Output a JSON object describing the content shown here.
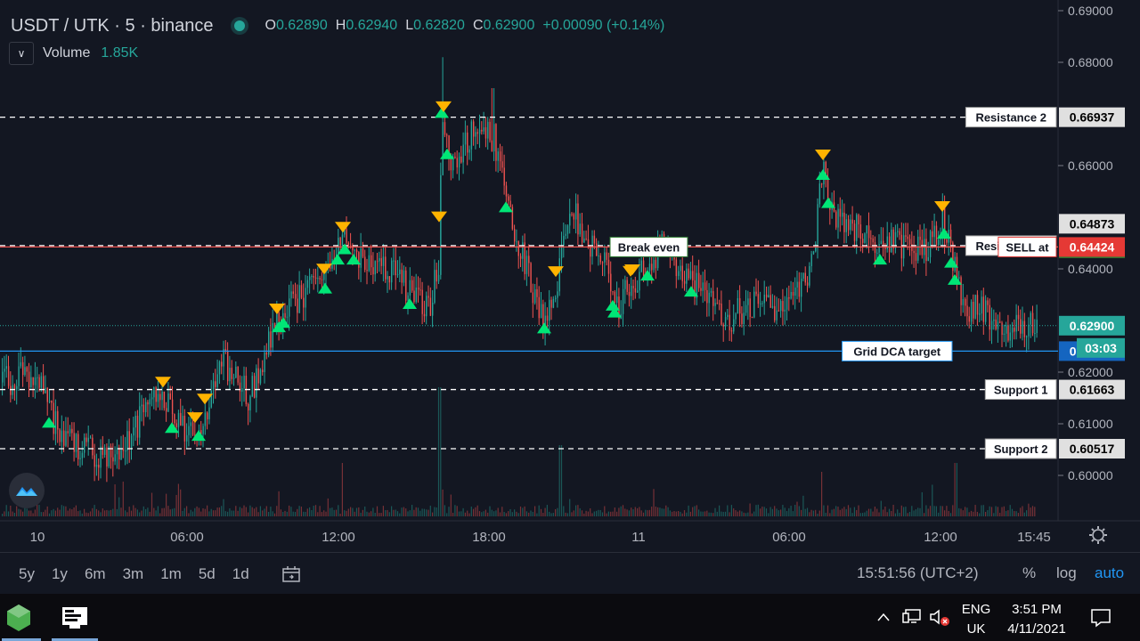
{
  "header": {
    "symbol": "USDT / UTK · 5 · binance",
    "ohlc": [
      {
        "key": "O",
        "val": "0.62890"
      },
      {
        "key": "H",
        "val": "0.62940"
      },
      {
        "key": "L",
        "val": "0.62820"
      },
      {
        "key": "C",
        "val": "0.62900"
      },
      {
        "key": "",
        "val": "+0.00090 (+0.14%)"
      }
    ]
  },
  "volume": {
    "label": "Volume",
    "value": "1.85K"
  },
  "colors": {
    "bg": "#131722",
    "up": "#26a69a",
    "down": "#ef5350",
    "buy_marker": "#00e676",
    "sell_marker": "#ffb300",
    "accent": "#2196f3"
  },
  "chart_data": {
    "type": "candlestick",
    "y_axis": {
      "min": 0.59,
      "max": 0.69,
      "ticks": [
        "0.69000",
        "0.68000",
        "0.66000",
        "0.64000",
        "0.62000",
        "0.61000",
        "0.60000"
      ]
    },
    "x_axis": {
      "ticks": [
        "10",
        "06:00",
        "12:00",
        "18:00",
        "11",
        "06:00",
        "12:00",
        "15:45"
      ]
    },
    "lines": [
      {
        "name": "Resistance 2",
        "value": 0.66937,
        "label": "Resistance 2",
        "price_label": "0.66937",
        "style": "dashed",
        "color": "#ffffff"
      },
      {
        "name": "Resistance 1",
        "value": 0.6445,
        "label": "Resistance 1",
        "price_label": "0.64450",
        "style": "dashed",
        "color": "#ffffff"
      },
      {
        "name": "SELL at",
        "value": 0.64424,
        "label": "SELL at",
        "price_label": "0.64424",
        "style": "solid",
        "color": "#ef5350"
      },
      {
        "name": "Break even",
        "value": 0.64424,
        "label": "Break even"
      },
      {
        "name": "Grid DCA target",
        "value": 0.62407,
        "label": "Grid DCA target",
        "price_label": "0.62407",
        "style": "solid",
        "color": "#2196f3"
      },
      {
        "name": "Support 1",
        "value": 0.61663,
        "label": "Support 1",
        "price_label": "0.61663",
        "style": "dashed",
        "color": "#ffffff"
      },
      {
        "name": "Support 2",
        "value": 0.60517,
        "label": "Support 2",
        "price_label": "0.60517",
        "style": "dashed",
        "color": "#ffffff"
      }
    ],
    "price_tags": [
      {
        "value": 0.64873,
        "text": "0.64873",
        "bg": "#e0e0e0",
        "fg": "#000000"
      },
      {
        "value": 0.629,
        "text": "0.62900",
        "bg": "#26a69a",
        "fg": "#ffffff"
      }
    ],
    "countdown": "03:03",
    "buy_markers_x": [
      55,
      193,
      223,
      313,
      318,
      365,
      379,
      387,
      397,
      460,
      496,
      502,
      568,
      611,
      688,
      690,
      727,
      776,
      924,
      930,
      988,
      1060,
      1068,
      1072
    ],
    "sell_markers_x": [
      183,
      219,
      230,
      311,
      364,
      385,
      493,
      498,
      624,
      710,
      708,
      734,
      924,
      1058
    ],
    "anchor_closes": [
      [
        0,
        0.618
      ],
      [
        40,
        0.62
      ],
      [
        55,
        0.612
      ],
      [
        80,
        0.606
      ],
      [
        110,
        0.604
      ],
      [
        140,
        0.606
      ],
      [
        165,
        0.613
      ],
      [
        183,
        0.616
      ],
      [
        195,
        0.61
      ],
      [
        222,
        0.609
      ],
      [
        250,
        0.622
      ],
      [
        280,
        0.615
      ],
      [
        310,
        0.63
      ],
      [
        340,
        0.635
      ],
      [
        365,
        0.638
      ],
      [
        385,
        0.646
      ],
      [
        400,
        0.643
      ],
      [
        420,
        0.64
      ],
      [
        440,
        0.64
      ],
      [
        460,
        0.635
      ],
      [
        480,
        0.632
      ],
      [
        492,
        0.64
      ],
      [
        496,
        0.672
      ],
      [
        505,
        0.66
      ],
      [
        520,
        0.664
      ],
      [
        540,
        0.668
      ],
      [
        555,
        0.665
      ],
      [
        570,
        0.652
      ],
      [
        590,
        0.64
      ],
      [
        605,
        0.632
      ],
      [
        612,
        0.63
      ],
      [
        625,
        0.638
      ],
      [
        640,
        0.652
      ],
      [
        660,
        0.645
      ],
      [
        680,
        0.64
      ],
      [
        692,
        0.632
      ],
      [
        705,
        0.637
      ],
      [
        725,
        0.64
      ],
      [
        745,
        0.645
      ],
      [
        770,
        0.638
      ],
      [
        790,
        0.636
      ],
      [
        815,
        0.63
      ],
      [
        840,
        0.633
      ],
      [
        865,
        0.632
      ],
      [
        890,
        0.636
      ],
      [
        910,
        0.64
      ],
      [
        924,
        0.66
      ],
      [
        935,
        0.65
      ],
      [
        960,
        0.648
      ],
      [
        985,
        0.643
      ],
      [
        1000,
        0.646
      ],
      [
        1020,
        0.644
      ],
      [
        1040,
        0.643
      ],
      [
        1058,
        0.65
      ],
      [
        1068,
        0.643
      ],
      [
        1080,
        0.633
      ],
      [
        1100,
        0.632
      ],
      [
        1130,
        0.629
      ],
      [
        1160,
        0.629
      ]
    ]
  },
  "bottom_bar": {
    "ranges": [
      "5y",
      "1y",
      "6m",
      "3m",
      "1m",
      "5d",
      "1d"
    ],
    "clock": "15:51:56 (UTC+2)",
    "percent": "%",
    "log": "log",
    "auto": "auto"
  },
  "taskbar": {
    "lang_top": "ENG",
    "lang_bottom": "UK",
    "time": "3:51 PM",
    "date": "4/11/2021"
  }
}
